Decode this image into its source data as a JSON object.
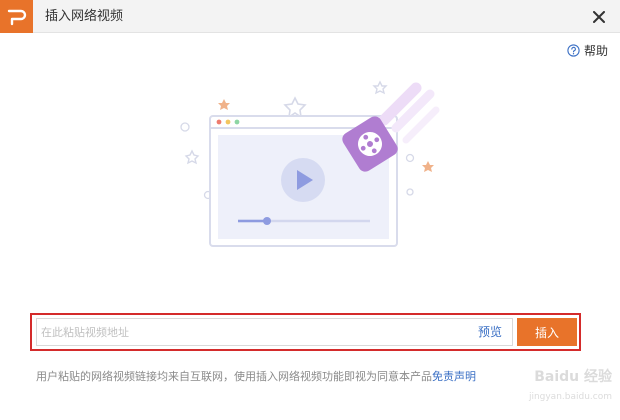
{
  "window": {
    "title": "插入网络视频",
    "close_icon": "close-icon",
    "logo_icon": "wps-p-logo-icon"
  },
  "help": {
    "label": "帮助",
    "icon": "question-circle-icon"
  },
  "illustration": {
    "description_icon": "video-player-illustration"
  },
  "url_input": {
    "placeholder": "在此粘贴视频地址",
    "value": ""
  },
  "preview": {
    "label": "预览"
  },
  "insert_button": {
    "label": "插入"
  },
  "disclaimer": {
    "text": "用户粘贴的网络视频链接均来自互联网，使用插入网络视频功能即视为同意本产品",
    "link": "免责声明"
  },
  "watermark": {
    "text": "Baidu 经验",
    "sub": "jingyan.baidu.com"
  },
  "colors": {
    "accent": "#e8732a",
    "link": "#3a6fc4",
    "highlight_border": "#d42b2b",
    "illustration_purple": "#b07dd1"
  }
}
